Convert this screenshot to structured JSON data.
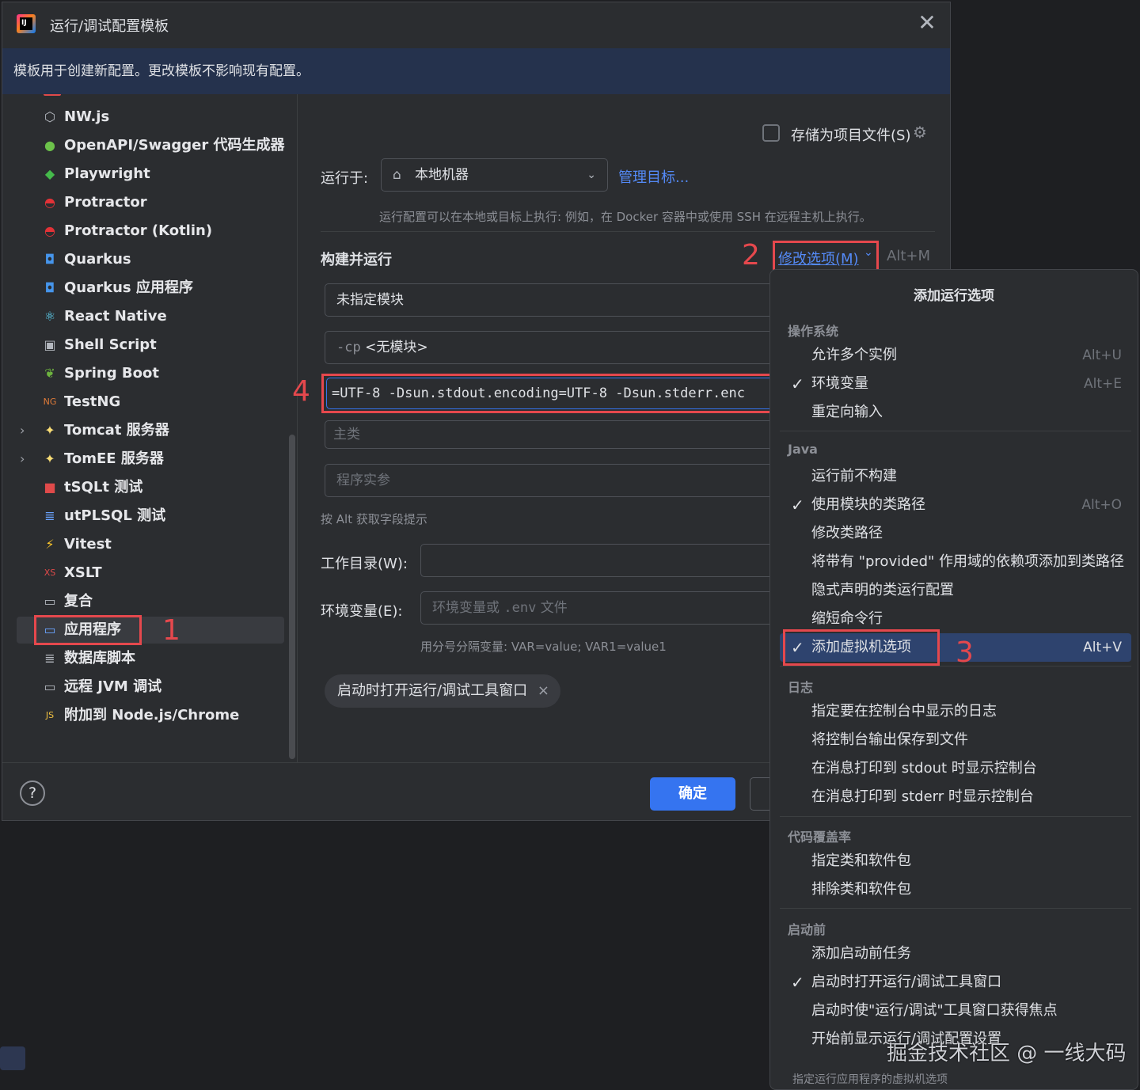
{
  "window": {
    "title": "运行/调试配置模板",
    "close_glyph": "✕",
    "banner": "模板用于创建新配置。更改模板不影响现有配置。"
  },
  "sidebar": {
    "items": [
      {
        "label": "NW.js",
        "icon": "hexagon-icon",
        "glyph": "⬡",
        "color": "#b4b8bf"
      },
      {
        "label": "OpenAPI/Swagger 代码生成器",
        "icon": "openapi-icon",
        "glyph": "●",
        "color": "#6cc24a"
      },
      {
        "label": "Playwright",
        "icon": "playwright-icon",
        "glyph": "◆",
        "color": "#45ba4b"
      },
      {
        "label": "Protractor",
        "icon": "protractor-icon",
        "glyph": "◓",
        "color": "#e23237"
      },
      {
        "label": "Protractor (Kotlin)",
        "icon": "protractor-icon",
        "glyph": "◓",
        "color": "#e23237"
      },
      {
        "label": "Quarkus",
        "icon": "quarkus-icon",
        "glyph": "◘",
        "color": "#4695eb"
      },
      {
        "label": "Quarkus 应用程序",
        "icon": "quarkus-icon",
        "glyph": "◘",
        "color": "#4695eb"
      },
      {
        "label": "React Native",
        "icon": "react-icon",
        "glyph": "⚛",
        "color": "#61dafb"
      },
      {
        "label": "Shell Script",
        "icon": "terminal-icon",
        "glyph": "▣",
        "color": "#b4b8bf"
      },
      {
        "label": "Spring Boot",
        "icon": "spring-icon",
        "glyph": "❦",
        "color": "#6db33f"
      },
      {
        "label": "TestNG",
        "icon": "testng-icon",
        "glyph": "NG",
        "color": "#e07b39"
      },
      {
        "label": "Tomcat 服务器",
        "icon": "tomcat-icon",
        "glyph": "✦",
        "color": "#f8dc75",
        "expandable": true
      },
      {
        "label": "TomEE 服务器",
        "icon": "tomee-icon",
        "glyph": "✦",
        "color": "#f8dc75",
        "expandable": true
      },
      {
        "label": "tSQLt 测试",
        "icon": "tsqlt-icon",
        "glyph": "■",
        "color": "#e04a4a"
      },
      {
        "label": "utPLSQL 测试",
        "icon": "database-icon",
        "glyph": "≣",
        "color": "#6aa4ff"
      },
      {
        "label": "Vitest",
        "icon": "vitest-icon",
        "glyph": "⚡",
        "color": "#fcc72b"
      },
      {
        "label": "XSLT",
        "icon": "xslt-icon",
        "glyph": "XS",
        "color": "#e04a4a"
      },
      {
        "label": "复合",
        "icon": "folder-icon",
        "glyph": "▭",
        "color": "#b4b8bf"
      },
      {
        "label": "应用程序",
        "icon": "application-icon",
        "glyph": "▭",
        "color": "#6aa4ff",
        "selected": true
      },
      {
        "label": "数据库脚本",
        "icon": "database-script-icon",
        "glyph": "≣",
        "color": "#b4b8bf"
      },
      {
        "label": "远程 JVM 调试",
        "icon": "remote-debug-icon",
        "glyph": "▭",
        "color": "#b4b8bf"
      },
      {
        "label": "附加到 Node.js/Chrome",
        "icon": "nodejs-icon",
        "glyph": "JS",
        "color": "#f0c040"
      }
    ]
  },
  "annotations": {
    "one": "1",
    "two": "2",
    "three": "3",
    "four": "4"
  },
  "main": {
    "store_as_file": "存储为项目文件(S)",
    "run_on_label": "运行于:",
    "run_on_value": "本地机器",
    "manage_targets": "管理目标...",
    "run_on_hint": "运行配置可以在本地或目标上执行: 例如，在 Docker 容器中或使用 SSH 在远程主机上执行。",
    "build_run_title": "构建并运行",
    "modify_options": "修改选项(M)",
    "modify_shortcut": "Alt+M",
    "module_value": "未指定模块",
    "cp_prefix": "-cp",
    "cp_value": "<无模块>",
    "vm_options_value": "=UTF-8 -Dsun.stdout.encoding=UTF-8 -Dsun.stderr.enc",
    "main_class_placeholder": "主类",
    "program_args_placeholder": "程序实参",
    "alt_hint": "按 Alt 获取字段提示",
    "workdir_label": "工作目录(W):",
    "env_label": "环境变量(E):",
    "env_placeholder_a": "环境变量或",
    "env_placeholder_b": ".env",
    "env_placeholder_c": "文件",
    "env_hint": "用分号分隔变量: VAR=value; VAR1=value1",
    "chip_label": "启动时打开运行/调试工具窗口",
    "chip_close": "×"
  },
  "footer": {
    "help": "?",
    "ok": "确定"
  },
  "popup": {
    "title": "添加运行选项",
    "sections": {
      "os": "操作系统",
      "java": "Java",
      "log": "日志",
      "coverage": "代码覆盖率",
      "before": "启动前"
    },
    "items": {
      "allow_multiple": {
        "label": "允许多个实例",
        "shortcut": "Alt+U"
      },
      "env_vars": {
        "label": "环境变量",
        "shortcut": "Alt+E",
        "checked": true
      },
      "redirect_input": {
        "label": "重定向输入"
      },
      "no_build": {
        "label": "运行前不构建"
      },
      "module_classpath": {
        "label": "使用模块的类路径",
        "shortcut": "Alt+O",
        "checked": true
      },
      "modify_classpath": {
        "label": "修改类路径"
      },
      "provided_deps": {
        "label": "将带有 \"provided\" 作用域的依赖项添加到类路径"
      },
      "implicit_class": {
        "label": "隐式声明的类运行配置"
      },
      "shorten_cmd": {
        "label": "缩短命令行"
      },
      "add_vm_options": {
        "label": "添加虚拟机选项",
        "shortcut": "Alt+V",
        "checked": true,
        "active": true
      },
      "log_console": {
        "label": "指定要在控制台中显示的日志"
      },
      "save_console": {
        "label": "将控制台输出保存到文件"
      },
      "stdout_show": {
        "label": "在消息打印到 stdout 时显示控制台"
      },
      "stderr_show": {
        "label": "在消息打印到 stderr 时显示控制台"
      },
      "cov_include": {
        "label": "指定类和软件包"
      },
      "cov_exclude": {
        "label": "排除类和软件包"
      },
      "before_task": {
        "label": "添加启动前任务"
      },
      "open_tool_window": {
        "label": "启动时打开运行/调试工具窗口",
        "checked": true
      },
      "focus_tool_window": {
        "label": "启动时使\"运行/调试\"工具窗口获得焦点"
      },
      "show_settings": {
        "label": "开始前显示运行/调试配置设置"
      }
    },
    "footer_hint": "指定运行应用程序的虚拟机选项"
  },
  "watermark": "掘金技术社区 @ 一线大码",
  "colors": {
    "accent": "#3574f0",
    "annotation_red": "#e5484d",
    "link": "#548af7"
  }
}
